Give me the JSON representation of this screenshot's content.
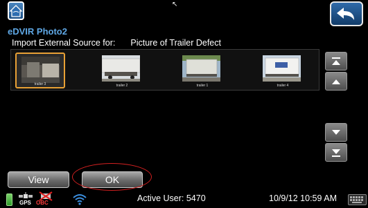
{
  "header": {
    "app_title": "eDVIR Photo2",
    "import_label": "Import External Source for:",
    "import_target": "Picture of Trailer Defect"
  },
  "thumbnails": [
    {
      "caption": "trailer 3",
      "selected": true
    },
    {
      "caption": "trailer 2",
      "selected": false
    },
    {
      "caption": "trailer 1",
      "selected": false
    },
    {
      "caption": "trailer 4",
      "selected": false
    }
  ],
  "buttons": {
    "view": "View",
    "ok": "OK"
  },
  "status_bar": {
    "gps_label": "GPS",
    "obc_label": "OBC",
    "active_user": "Active User: 5470",
    "datetime": "10/9/12 10:59 AM"
  },
  "colors": {
    "accent_title": "#5fa8e6",
    "selection_border": "#e9a135",
    "highlight_ring": "#d42020",
    "battery": "#3aa832"
  },
  "icons": [
    "home-icon",
    "back-arrow-icon",
    "scroll-top-icon",
    "scroll-up-icon",
    "scroll-down-icon",
    "scroll-bottom-icon",
    "battery-icon",
    "gps-icon",
    "obc-disconnected-icon",
    "wifi-icon",
    "keyboard-icon"
  ]
}
